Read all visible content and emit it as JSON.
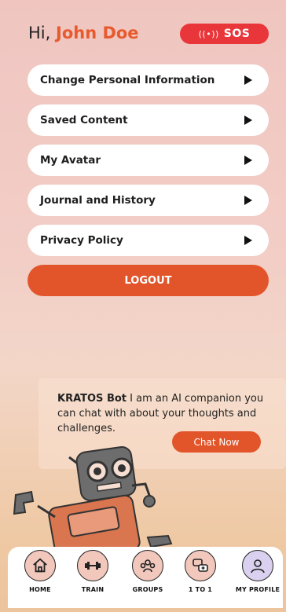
{
  "header": {
    "greeting": "Hi,",
    "user_name": "John Doe",
    "sos_label": "SOS",
    "sos_icon": "((•))"
  },
  "menu": [
    {
      "label": "Change Personal Information"
    },
    {
      "label": "Saved Content"
    },
    {
      "label": "My Avatar"
    },
    {
      "label": "Journal and History"
    },
    {
      "label": "Privacy Policy"
    }
  ],
  "logout_label": "LOGOUT",
  "bot": {
    "name": "KRATOS Bot",
    "message": " I am an AI companion you can chat with about your thoughts and challenges.",
    "chat_button": "Chat Now"
  },
  "nav": [
    {
      "label": "HOME",
      "icon": "home-icon"
    },
    {
      "label": "TRAIN",
      "icon": "dumbbell-icon"
    },
    {
      "label": "GROUPS",
      "icon": "group-icon"
    },
    {
      "label": "1 TO 1",
      "icon": "chat-bubbles-icon"
    },
    {
      "label": "MY PROFILE",
      "icon": "profile-icon",
      "active": true
    }
  ],
  "colors": {
    "accent": "#e2552b",
    "sos": "#e8363a",
    "name": "#e75a2e"
  }
}
